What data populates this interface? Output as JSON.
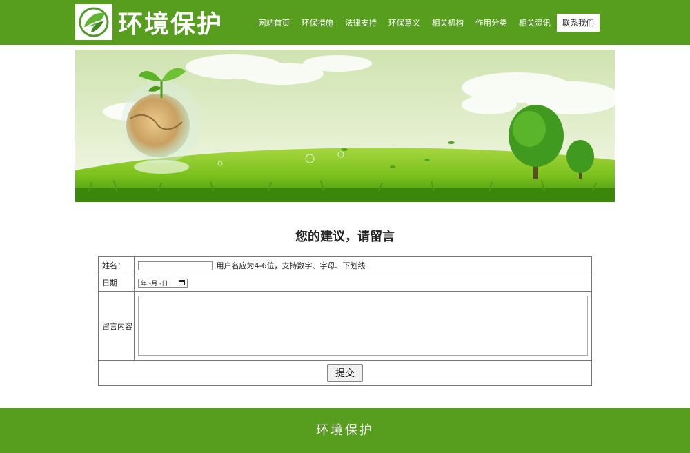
{
  "header": {
    "site_title": "环境保护",
    "nav": [
      {
        "label": "网站首页"
      },
      {
        "label": "环保措施"
      },
      {
        "label": "法律支持"
      },
      {
        "label": "环保意义"
      },
      {
        "label": "相关机构"
      },
      {
        "label": "作用分类"
      },
      {
        "label": "相关资讯"
      },
      {
        "label": "联系我们",
        "active": true
      }
    ]
  },
  "form": {
    "title": "您的建议，请留言",
    "name_label": "姓名：",
    "name_value": "",
    "name_hint": "用户名应为4-6位，支持数字、字母、下划线",
    "date_label": "日期",
    "date_year": "年",
    "date_month": "-月",
    "date_day": "-日",
    "message_label": "留言内容",
    "message_value": "",
    "submit_label": "提交"
  },
  "footer": {
    "text": "环境保护"
  },
  "colors": {
    "brand_green": "#579e1f"
  },
  "icons": {
    "logo": "leaf-logo-icon",
    "calendar": "calendar-icon"
  }
}
